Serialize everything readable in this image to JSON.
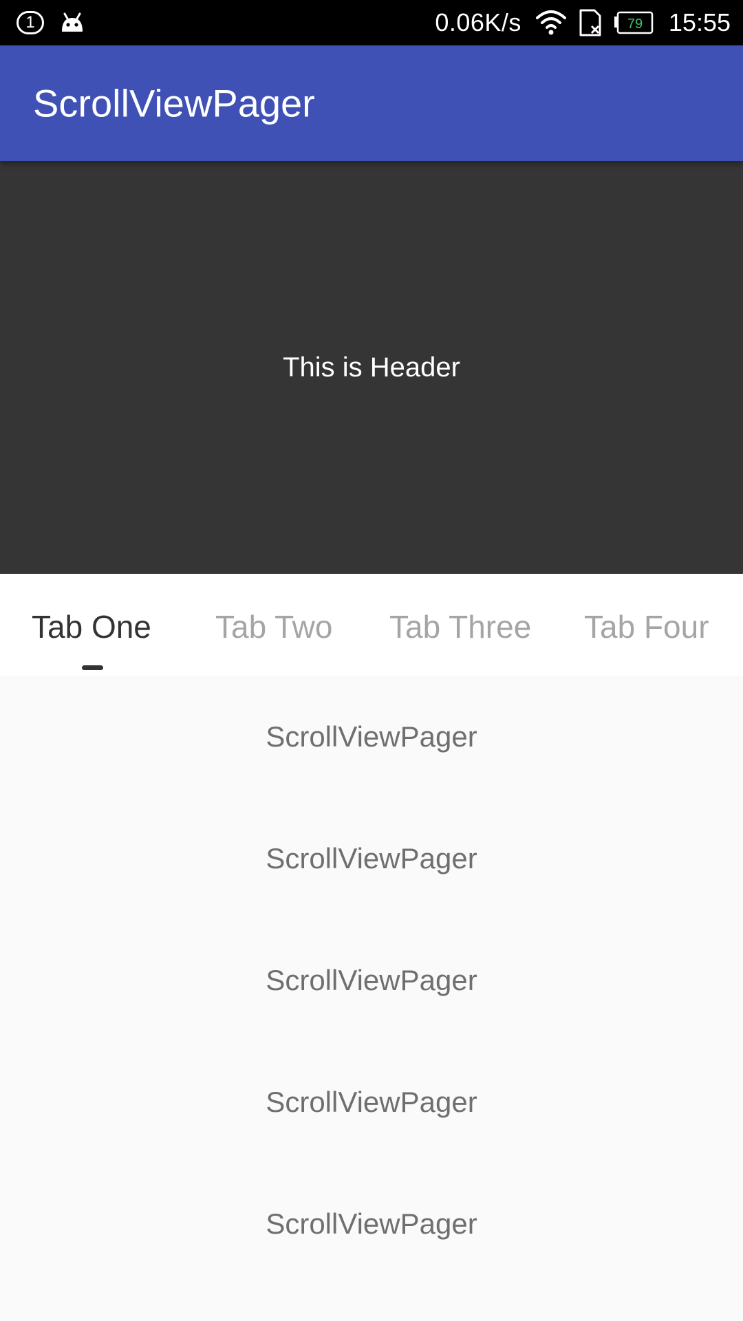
{
  "status_bar": {
    "notification_count": "1",
    "net_speed": "0.06K/s",
    "battery_level": "79",
    "time": "15:55",
    "icons": [
      "circled-one-icon",
      "android-icon",
      "wifi-icon",
      "sim-card-missing-icon",
      "battery-icon"
    ]
  },
  "app_bar": {
    "title": "ScrollViewPager",
    "color": "#3f51b5"
  },
  "header": {
    "text": "This is Header",
    "background": "#353535"
  },
  "tabs": {
    "items": [
      {
        "label": "Tab One",
        "active": true
      },
      {
        "label": "Tab Two",
        "active": false
      },
      {
        "label": "Tab Three",
        "active": false
      },
      {
        "label": "Tab Four",
        "active": false
      }
    ]
  },
  "list": {
    "items": [
      {
        "label": "ScrollViewPager"
      },
      {
        "label": "ScrollViewPager"
      },
      {
        "label": "ScrollViewPager"
      },
      {
        "label": "ScrollViewPager"
      },
      {
        "label": "ScrollViewPager"
      }
    ]
  }
}
